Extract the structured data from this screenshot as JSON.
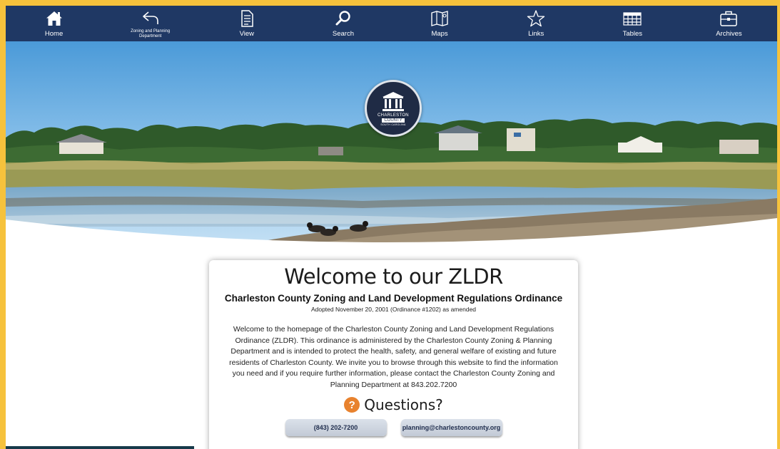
{
  "nav": {
    "items": [
      {
        "key": "home",
        "label": "Home",
        "icon": "home-icon"
      },
      {
        "key": "zoning",
        "label": "Zoning and Planning Department",
        "icon": "back-arrow-icon"
      },
      {
        "key": "view",
        "label": "View",
        "icon": "document-icon"
      },
      {
        "key": "search",
        "label": "Search",
        "icon": "search-icon"
      },
      {
        "key": "maps",
        "label": "Maps",
        "icon": "map-icon"
      },
      {
        "key": "links",
        "label": "Links",
        "icon": "star-icon"
      },
      {
        "key": "tables",
        "label": "Tables",
        "icon": "table-icon"
      },
      {
        "key": "archives",
        "label": "Archives",
        "icon": "briefcase-icon"
      }
    ],
    "background": "#1f3864"
  },
  "seal": {
    "line1": "CHARLESTON",
    "line2": "COUNTY",
    "line3": "SOUTH CAROLINA"
  },
  "card": {
    "title": "Welcome to our ZLDR",
    "subtitle": "Charleston County Zoning and Land Development Regulations Ordinance",
    "adopted": "Adopted November 20, 2001 (Ordinance #1202) as amended",
    "body": "Welcome to the homepage of the Charleston County Zoning and Land Development Regulations Ordinance (ZLDR). This ordinance is administered by the Charleston County Zoning & Planning Department and is intended to protect the health, safety, and general welfare of existing and future residents of Charleston County. We invite you to browse through this website to find the information you need and if you require further information, please contact the Charleston County Zoning and Planning Department at 843.202.7200",
    "questions_icon": "?",
    "questions_label": "Questions?",
    "phone_button": "(843) 202-7200",
    "email_button": "planning@charlestoncounty.org"
  },
  "colors": {
    "border": "#f6c23c",
    "nav": "#1f3864",
    "question_accent": "#e8822e"
  }
}
